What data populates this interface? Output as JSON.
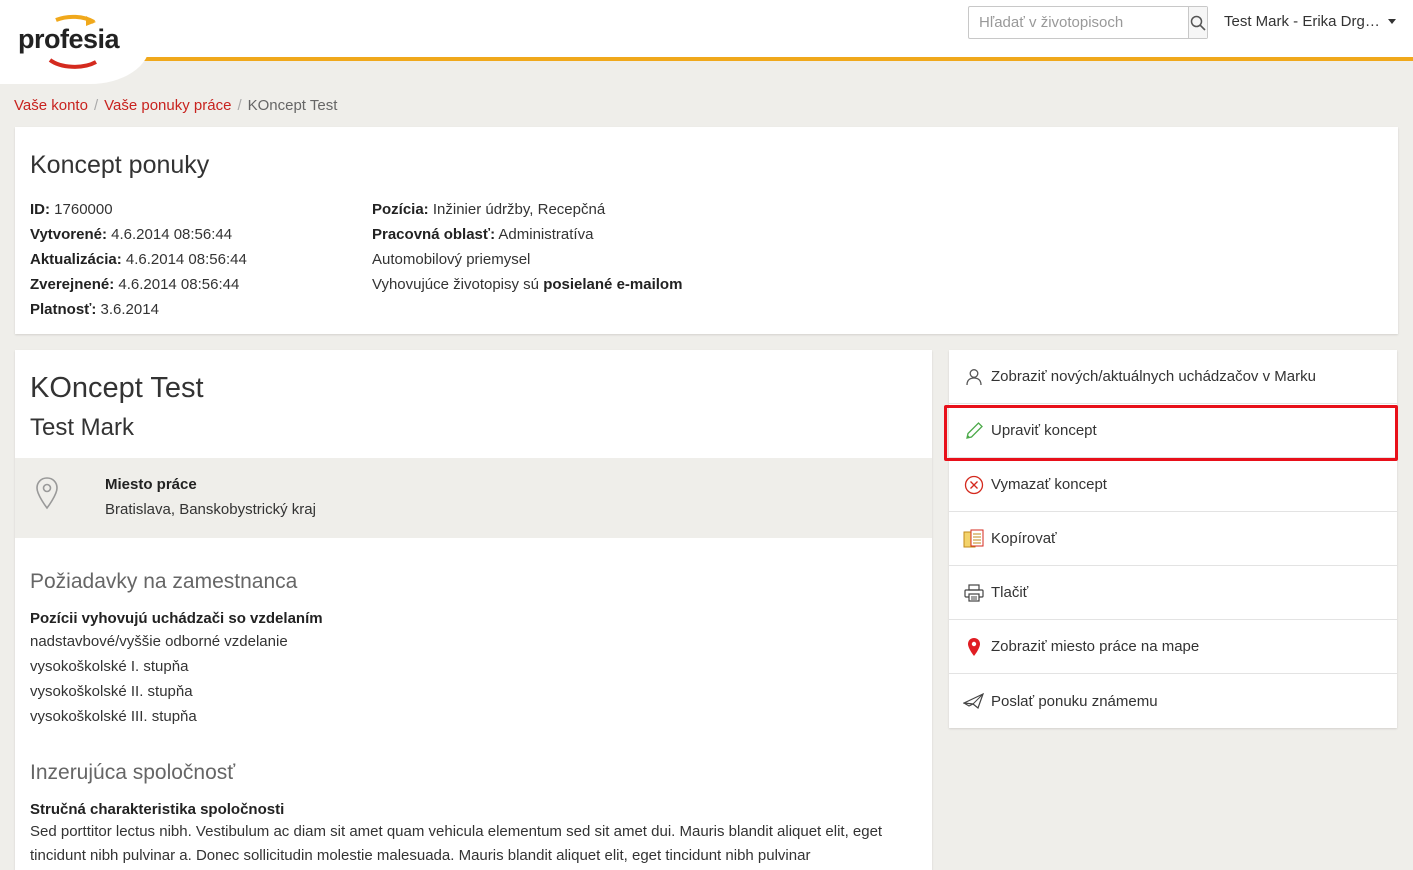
{
  "header": {
    "logo_text": "profesia",
    "search_placeholder": "Hľadať v životopisoch",
    "user_name": "Test Mark - Erika Drg…"
  },
  "breadcrumb": {
    "items": [
      "Vaše konto",
      "Vaše ponuky práce"
    ],
    "separator": "/",
    "current": "KOncept Test"
  },
  "info": {
    "title": "Koncept ponuky",
    "left": [
      {
        "label": "ID:",
        "value": " 1760000"
      },
      {
        "label": "Vytvorené:",
        "value": " 4.6.2014 08:56:44"
      },
      {
        "label": "Aktualizácia:",
        "value": " 4.6.2014 08:56:44"
      },
      {
        "label": "Zverejnené:",
        "value": " 4.6.2014 08:56:44"
      },
      {
        "label": "Platnosť:",
        "value": " 3.6.2014"
      }
    ],
    "right": {
      "pozicia_label": "Pozícia:",
      "pozicia_value": " Inžinier údržby, Recepčná",
      "oblast_label": "Pracovná oblasť:",
      "oblast_value": " Administratíva",
      "industry": "Automobilový priemysel",
      "email_prefix": "Vyhovujúce životopisy sú ",
      "email_bold": "posielané e-mailom"
    }
  },
  "job": {
    "title": "KOncept Test",
    "company": "Test Mark",
    "location_label": "Miesto práce",
    "location_value": "Bratislava, Banskobystrický kraj",
    "req_heading": "Požiadavky na zamestnanca",
    "req_sub": "Pozícii vyhovujú uchádzači so vzdelaním",
    "education": [
      "nadstavbové/vyššie odborné vzdelanie",
      "vysokoškolské I. stupňa",
      "vysokoškolské II. stupňa",
      "vysokoškolské III. stupňa"
    ],
    "company_heading": "Inzerujúca spoločnosť",
    "company_sub": "Stručná charakteristika spoločnosti",
    "company_desc": "Sed porttitor lectus nibh. Vestibulum ac diam sit amet quam vehicula elementum sed sit amet dui. Mauris blandit aliquet elit, eget tincidunt nibh pulvinar a. Donec sollicitudin molestie malesuada. Mauris blandit aliquet elit, eget tincidunt nibh pulvinar"
  },
  "actions": [
    {
      "label": "Zobraziť nových/aktuálnych uchádzačov v Marku",
      "icon": "user-icon"
    },
    {
      "label": "Upraviť koncept",
      "icon": "pencil-icon"
    },
    {
      "label": "Vymazať koncept",
      "icon": "delete-circle-icon"
    },
    {
      "label": "Kopírovať",
      "icon": "copy-icon"
    },
    {
      "label": "Tlačiť",
      "icon": "printer-icon"
    },
    {
      "label": "Zobraziť miesto práce na mape",
      "icon": "map-pin-icon"
    },
    {
      "label": "Poslať ponuku známemu",
      "icon": "send-icon"
    }
  ],
  "colors": {
    "accent_link": "#c8231f",
    "header_line": "#f0a81b",
    "highlight": "#e8101a"
  }
}
